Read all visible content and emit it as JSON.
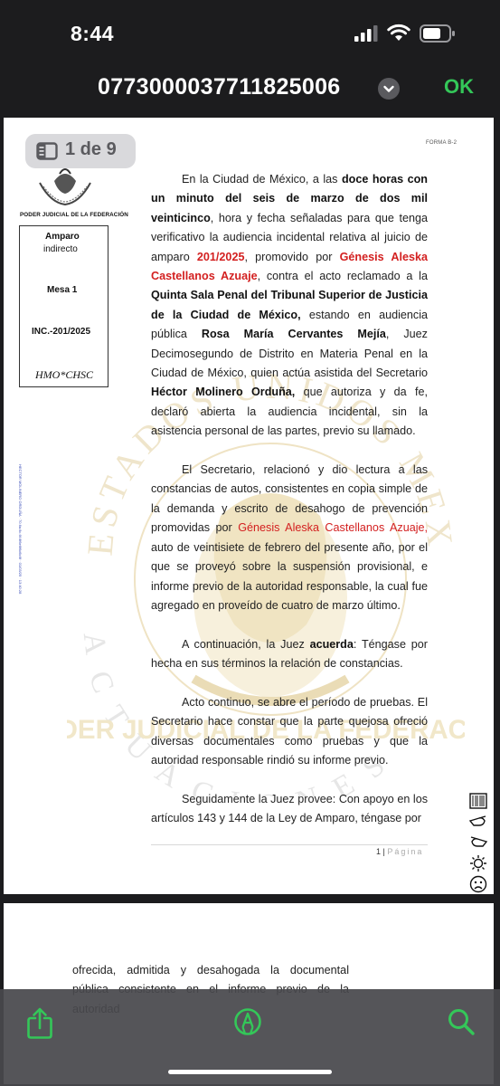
{
  "status_bar": {
    "time": "8:44"
  },
  "nav": {
    "title": "077300003771182​5006",
    "ok_label": "OK"
  },
  "viewer": {
    "page_counter": "1 de 9"
  },
  "document": {
    "forma": "FORMA B-2",
    "institution": "PODER JUDICIAL DE LA FEDERACIÓN",
    "case_box": {
      "line1": "Amparo",
      "line2": "indirecto",
      "mesa": "Mesa 1",
      "inc": "INC.-201/2025",
      "initials": "HMO*CHSC"
    },
    "side_stamp": "HECTOR MOLINERO ORDUÑA · 70.6a.6c.6f.6f6e6f6d6c6f · 01/03/25 · 13:40:28",
    "p1": {
      "a": "En la Ciudad de México, a las ",
      "b": "doce horas con un minuto del seis de marzo de dos mil veinticinco",
      "c": ", hora y fecha señaladas para que tenga verificativo la audiencia incidental relativa al juicio de amparo ",
      "d": "201/2025",
      "e": ", promovido por ",
      "f": "Génesis Aleska Castellanos Azuaje",
      "g": ", contra el acto reclamado a la ",
      "h": "Quinta Sala Penal del Tribunal Superior de Justicia de la Ciudad de México,",
      "i": " estando en audiencia pública ",
      "j": "Rosa María Cervantes Mejía",
      "k": ", Juez Decimosegundo de Distrito en Materia Penal en la Ciudad de México, quien actúa asistida del Secretario ",
      "l": "Héctor Molinero Orduña,",
      "m": " que autoriza y da fe, declaró abierta la audiencia incidental, sin la asistencia personal de las partes, previo su llamado."
    },
    "p2": {
      "a": "El Secretario, relacionó y dio lectura a las constancias de autos, consistentes en copia simple de la demanda y escrito de desahogo de prevención promovidas por ",
      "b": "Génesis Aleska Castellanos Azuaje,",
      "c": " auto de veintisiete de febrero del presente año, por el que se proveyó sobre la suspensión provisional, e informe previo de la autoridad responsable, la cual fue agregado en proveído de cuatro de marzo último."
    },
    "p3": {
      "a": "A continuación, la Juez ",
      "b": "acuerda",
      "c": ": Téngase por hecha en sus términos la relación de constancias."
    },
    "p4": "Acto continuo, se abre el período de pruebas. El Secretario hace constar que la parte quejosa ofreció diversas documentales como pruebas y que la autoridad responsable rindió su informe previo.",
    "p5": "Seguidamente la Juez provee: Con apoyo en los artículos 143 y 144 de la Ley de Amparo, téngase por",
    "page_number": "1",
    "page_word": "Página",
    "watermark_text": "PODER JUDICIAL DE LA FEDERACIÓN",
    "watermark_arc": "ESTADOS UNIDOS MEXICANOS",
    "watermark_arc2": "ACTUACIONES",
    "page2_text": "ofrecida, admitida y desahogada la documental pública consistente en el informe previo de la autoridad"
  },
  "colors": {
    "accent": "#34c759",
    "red_text": "#d32020",
    "stamp_blue": "#3347b5"
  },
  "icons": {
    "signal": "cellular-signal-icon",
    "wifi": "wifi-icon",
    "battery": "battery-icon",
    "sidebar": "sidebar-icon",
    "share": "share-icon",
    "markup": "markup-pen-icon",
    "search": "search-icon"
  }
}
